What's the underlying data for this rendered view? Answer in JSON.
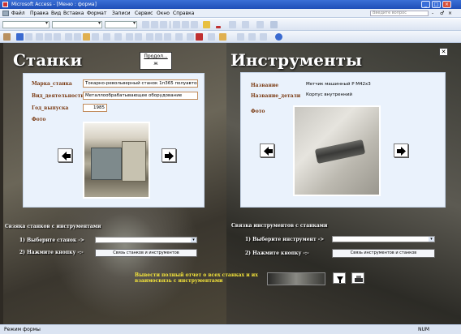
{
  "window": {
    "title": "Microsoft Access - [Меню : форма]",
    "buttons": [
      "_",
      "□",
      "×"
    ]
  },
  "menu": {
    "items": [
      "Файл",
      "Правка",
      "Вид",
      "Вставка",
      "Формат",
      "Записи",
      "Сервис",
      "Окно",
      "Справка"
    ],
    "help_placeholder": "Введите вопрос",
    "doc_buttons": [
      "-",
      "♂",
      "×"
    ]
  },
  "tooltip": {
    "label": "Продол...",
    "sub": "ж"
  },
  "left": {
    "heading": "Станки",
    "fields": [
      {
        "label": "Марка_станка",
        "value": "Токарно-револьверный станок  1п365 полуавтомат"
      },
      {
        "label": "Вид_деятельности",
        "value": "Металлообрабатывающее оборудование"
      },
      {
        "label": "Год_выпуска",
        "value": "1985"
      }
    ],
    "photo_label": "Фото",
    "link_section": "Свзяка станков с инструментами",
    "step1": "1) Выберите станок ->",
    "step2": "2) Нажмите кнопку -:-",
    "link_button": "Связь станков и инструментов"
  },
  "right": {
    "heading": "Инструменты",
    "fields": [
      {
        "label": "Название",
        "value": "Метчик машинный Р М42х3"
      },
      {
        "label": "Название_детали",
        "value": "Корпус внутренний"
      }
    ],
    "photo_label": "Фото",
    "link_section": "Связка инструментов с станками",
    "step1": "1) Выберите инструмент ->",
    "step2": "2) Нажмите кнопку -:-",
    "link_button": "Связь инструментов и станков"
  },
  "report_text": "Вывести полный отчет о всех станках и их взаимосвязь с инструментами",
  "status": {
    "left": "Режим формы",
    "right": "NUM"
  },
  "colors": {
    "title_bar": "#2c5cc7",
    "field_label": "#7a3a12",
    "report_text": "#f6e63a",
    "panel_bg": "#eaf2fc"
  }
}
